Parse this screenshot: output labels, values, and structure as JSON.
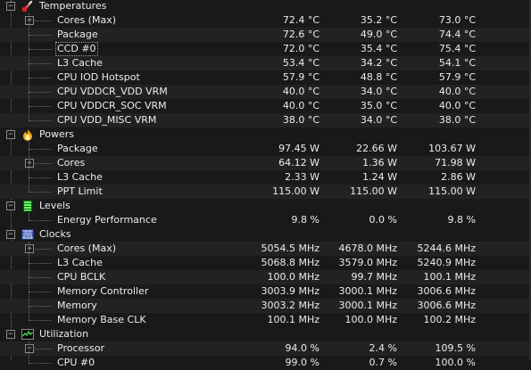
{
  "groups": [
    {
      "name": "Temperatures",
      "icon": "thermometer-icon",
      "rows": [
        {
          "name": "Cores (Max)",
          "expandable": true,
          "v1": "72.4 °C",
          "v2": "35.2 °C",
          "v3": "73.0 °C"
        },
        {
          "name": "Package",
          "v1": "72.6 °C",
          "v2": "49.0 °C",
          "v3": "74.4 °C"
        },
        {
          "name": "CCD #0",
          "selected": true,
          "v1": "72.0 °C",
          "v2": "35.4 °C",
          "v3": "75.4 °C"
        },
        {
          "name": "L3 Cache",
          "v1": "53.4 °C",
          "v2": "34.2 °C",
          "v3": "54.1 °C"
        },
        {
          "name": "CPU IOD Hotspot",
          "v1": "57.9 °C",
          "v2": "48.8 °C",
          "v3": "57.9 °C"
        },
        {
          "name": "CPU VDDCR_VDD VRM",
          "v1": "40.0 °C",
          "v2": "34.0 °C",
          "v3": "40.0 °C"
        },
        {
          "name": "CPU VDDCR_SOC VRM",
          "v1": "40.0 °C",
          "v2": "35.0 °C",
          "v3": "40.0 °C"
        },
        {
          "name": "CPU VDD_MISC VRM",
          "v1": "38.0 °C",
          "v2": "34.0 °C",
          "v3": "38.0 °C"
        }
      ]
    },
    {
      "name": "Powers",
      "icon": "flame-icon",
      "rows": [
        {
          "name": "Package",
          "v1": "97.45 W",
          "v2": "22.66 W",
          "v3": "103.67 W"
        },
        {
          "name": "Cores",
          "expandable": true,
          "v1": "64.12 W",
          "v2": "1.36 W",
          "v3": "71.98 W"
        },
        {
          "name": "L3 Cache",
          "v1": "2.33 W",
          "v2": "1.24 W",
          "v3": "2.86 W"
        },
        {
          "name": "PPT Limit",
          "v1": "115.00 W",
          "v2": "115.00 W",
          "v3": "115.00 W"
        }
      ]
    },
    {
      "name": "Levels",
      "icon": "levels-icon",
      "rows": [
        {
          "name": "Energy Performance",
          "v1": "9.8 %",
          "v2": "0.0 %",
          "v3": "9.8 %"
        }
      ]
    },
    {
      "name": "Clocks",
      "icon": "clock-chip-icon",
      "rows": [
        {
          "name": "Cores (Max)",
          "expandable": true,
          "v1": "5054.5 MHz",
          "v2": "4678.0 MHz",
          "v3": "5244.6 MHz"
        },
        {
          "name": "L3 Cache",
          "v1": "5068.8 MHz",
          "v2": "3579.0 MHz",
          "v3": "5240.9 MHz"
        },
        {
          "name": "CPU BCLK",
          "v1": "100.0 MHz",
          "v2": "99.7 MHz",
          "v3": "100.1 MHz"
        },
        {
          "name": "Memory Controller",
          "v1": "3003.9 MHz",
          "v2": "3000.1 MHz",
          "v3": "3006.6 MHz"
        },
        {
          "name": "Memory",
          "v1": "3003.2 MHz",
          "v2": "3000.1 MHz",
          "v3": "3006.6 MHz"
        },
        {
          "name": "Memory Base CLK",
          "v1": "100.1 MHz",
          "v2": "100.0 MHz",
          "v3": "100.2 MHz"
        }
      ]
    },
    {
      "name": "Utilization",
      "icon": "utilization-graph-icon",
      "rows": [
        {
          "name": "Processor",
          "expandable": true,
          "expanded": true,
          "v1": "94.0 %",
          "v2": "2.4 %",
          "v3": "109.5 %"
        },
        {
          "name": "CPU #0",
          "v1": "99.0 %",
          "v2": "0.7 %",
          "v3": "100.0 %"
        }
      ]
    }
  ],
  "colors": {
    "background": "#191919",
    "text": "#ececec",
    "alt_row": "#222222",
    "tree_lines": "#6a6a6a"
  }
}
